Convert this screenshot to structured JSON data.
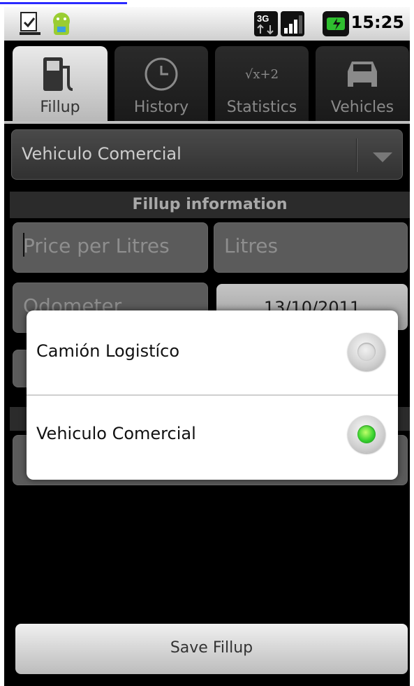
{
  "status_bar": {
    "time": "15:25",
    "network": "3G"
  },
  "tabs": [
    {
      "label": "Fillup",
      "icon": "fuel-pump-icon",
      "active": true
    },
    {
      "label": "History",
      "icon": "clock-icon",
      "active": false
    },
    {
      "label": "Statistics",
      "icon": "sqrt-icon",
      "icon_text": "√x+2",
      "active": false
    },
    {
      "label": "Vehicles",
      "icon": "car-icon",
      "active": false
    }
  ],
  "vehicle_spinner": {
    "value": "Vehiculo Comercial"
  },
  "section": {
    "title": "Fillup information"
  },
  "fields": {
    "price_placeholder": "Price per Litres",
    "litres_placeholder": "Litres",
    "odometer_placeholder": "Odometer",
    "date": "13/10/2011"
  },
  "dialog": {
    "options": [
      {
        "label": "Camión Logistíco",
        "selected": false
      },
      {
        "label": "Vehiculo Comercial",
        "selected": true
      }
    ]
  },
  "save_button": {
    "label": "Save Fillup"
  },
  "colors": {
    "selected_radio": "#38d22f",
    "dialog_bg": "#ffffff"
  }
}
